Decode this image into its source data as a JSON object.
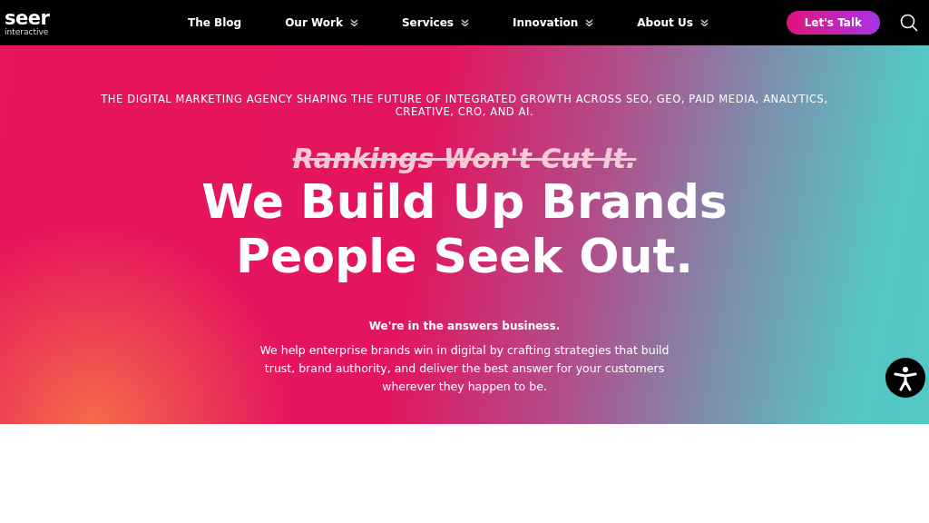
{
  "logo": {
    "name": "seer",
    "tagline": "interactive"
  },
  "nav": [
    {
      "label": "The Blog",
      "dropdown": false
    },
    {
      "label": "Our Work",
      "dropdown": true
    },
    {
      "label": "Services",
      "dropdown": true
    },
    {
      "label": "Innovation",
      "dropdown": true
    },
    {
      "label": "About Us",
      "dropdown": true
    }
  ],
  "cta": "Let's Talk",
  "hero": {
    "eyebrow": "THE DIGITAL MARKETING AGENCY SHAPING THE FUTURE OF INTEGRATED GROWTH ACROSS SEO, GEO, PAID MEDIA, ANALYTICS, CREATIVE, CRO, AND AI.",
    "struck": "Rankings Won't Cut It.",
    "headline": "We Build Up Brands People Seek Out.",
    "subhead": "We're in the answers business.",
    "body": "We help enterprise brands win in digital by crafting strategies that build trust, brand authority, and deliver the best answer for your customers wherever they happen to be."
  }
}
